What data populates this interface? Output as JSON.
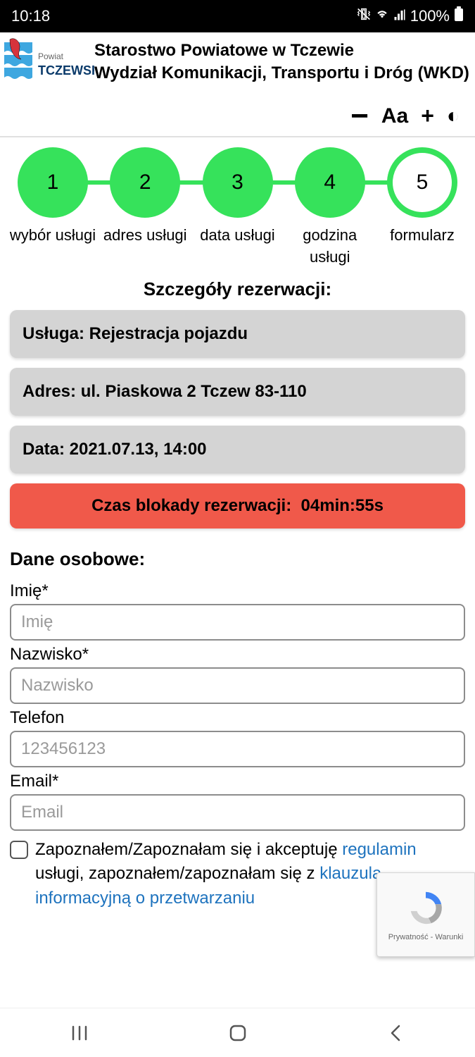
{
  "status": {
    "time": "10:18",
    "battery": "100%"
  },
  "header": {
    "line1": "Starostwo Powiatowe w Tczewie",
    "line2": "Wydział Komunikacji, Transportu i Dróg (WKD)",
    "logo_main": "TCZEWSKI",
    "logo_sub": "Powiat"
  },
  "stepper": {
    "steps": [
      {
        "num": "1",
        "label": "wybór usługi"
      },
      {
        "num": "2",
        "label": "adres usługi"
      },
      {
        "num": "3",
        "label": "data usługi"
      },
      {
        "num": "4",
        "label": "godzina usługi"
      },
      {
        "num": "5",
        "label": "formularz"
      }
    ]
  },
  "details": {
    "heading": "Szczegóły rezerwacji:",
    "service": "Usługa: Rejestracja pojazdu",
    "address": "Adres: ul. Piaskowa 2 Tczew 83-110",
    "datetime": "Data: 2021.07.13, 14:00",
    "timer_label": "Czas blokady rezerwacji:",
    "timer_value": "04min:55s"
  },
  "form": {
    "heading": "Dane osobowe:",
    "first_name_label": "Imię*",
    "first_name_placeholder": "Imię",
    "last_name_label": "Nazwisko*",
    "last_name_placeholder": "Nazwisko",
    "phone_label": "Telefon",
    "phone_placeholder": "123456123",
    "email_label": "Email*",
    "email_placeholder": "Email",
    "consent_pre": "Zapoznałem/Zapoznałam się i akceptuję ",
    "consent_link1": "regulamin",
    "consent_mid": " usługi, zapoznałem/zapoznałam się z ",
    "consent_link2": "klauzulą informacyjną o przetwarzaniu"
  },
  "recaptcha": {
    "footer": "Prywatność - Warunki"
  }
}
